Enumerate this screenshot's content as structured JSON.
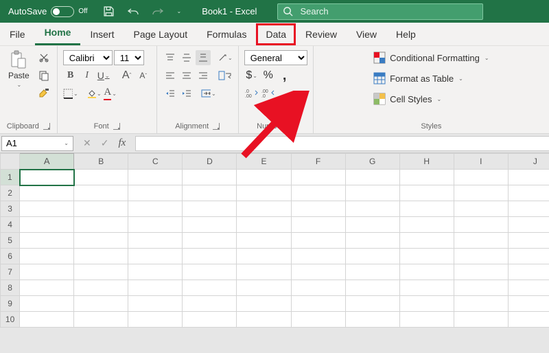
{
  "titlebar": {
    "autosave_label": "AutoSave",
    "autosave_state": "Off",
    "doc_title": "Book1  -  Excel",
    "search_placeholder": "Search"
  },
  "tabs": [
    "File",
    "Home",
    "Insert",
    "Page Layout",
    "Formulas",
    "Data",
    "Review",
    "View",
    "Help"
  ],
  "active_tab": "Home",
  "highlighted_tab": "Data",
  "ribbon": {
    "clipboard": {
      "paste": "Paste",
      "label": "Clipboard"
    },
    "font": {
      "label": "Font",
      "font_name": "Calibri",
      "font_size": "11",
      "bold": "B",
      "italic": "I",
      "underline": "U",
      "increase_a": "A",
      "decrease_a": "A",
      "fill_a": "A",
      "font_color_a": "A"
    },
    "alignment": {
      "label": "Alignment"
    },
    "number": {
      "label": "Number",
      "format": "General",
      "percent": "%"
    },
    "styles": {
      "label": "Styles",
      "cond_fmt": "Conditional Formatting",
      "fmt_table": "Format as Table",
      "cell_styles": "Cell Styles"
    }
  },
  "formula_bar": {
    "name_box": "A1",
    "fx": "fx"
  },
  "grid": {
    "columns": [
      "A",
      "B",
      "C",
      "D",
      "E",
      "F",
      "G",
      "H",
      "I",
      "J"
    ],
    "rows": [
      "1",
      "2",
      "3",
      "4",
      "5",
      "6",
      "7",
      "8",
      "9",
      "10"
    ],
    "active_cell": "A1"
  }
}
